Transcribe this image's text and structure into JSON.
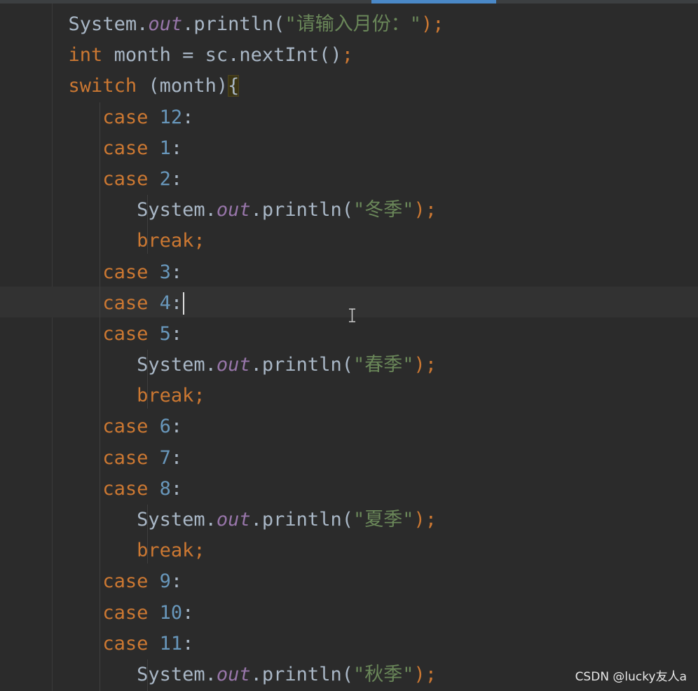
{
  "editor": {
    "lines": [
      {
        "indent": "      ",
        "tokens": [
          {
            "t": "System.",
            "c": ""
          },
          {
            "t": "out",
            "c": "fld"
          },
          {
            "t": ".println(",
            "c": ""
          },
          {
            "t": "\"请输入月份：\"",
            "c": "str"
          },
          {
            "t": ");",
            "c": "kw"
          }
        ]
      },
      {
        "indent": "      ",
        "tokens": [
          {
            "t": "int",
            "c": "kw"
          },
          {
            "t": " month = sc.nextInt()",
            "c": ""
          },
          {
            "t": ";",
            "c": "kw"
          }
        ]
      },
      {
        "indent": "      ",
        "tokens": [
          {
            "t": "switch",
            "c": "kw"
          },
          {
            "t": " (month)",
            "c": ""
          },
          {
            "t": "{",
            "c": "brace-hl"
          }
        ]
      },
      {
        "indent": "         ",
        "tokens": [
          {
            "t": "case ",
            "c": "kw"
          },
          {
            "t": "12",
            "c": "num"
          },
          {
            "t": ":",
            "c": ""
          }
        ]
      },
      {
        "indent": "         ",
        "tokens": [
          {
            "t": "case ",
            "c": "kw"
          },
          {
            "t": "1",
            "c": "num"
          },
          {
            "t": ":",
            "c": ""
          }
        ]
      },
      {
        "indent": "         ",
        "tokens": [
          {
            "t": "case ",
            "c": "kw"
          },
          {
            "t": "2",
            "c": "num"
          },
          {
            "t": ":",
            "c": ""
          }
        ]
      },
      {
        "indent": "            ",
        "tokens": [
          {
            "t": "System.",
            "c": ""
          },
          {
            "t": "out",
            "c": "fld"
          },
          {
            "t": ".println(",
            "c": ""
          },
          {
            "t": "\"冬季\"",
            "c": "str"
          },
          {
            "t": ");",
            "c": "kw"
          }
        ]
      },
      {
        "indent": "            ",
        "tokens": [
          {
            "t": "break;",
            "c": "kw"
          }
        ]
      },
      {
        "indent": "         ",
        "tokens": [
          {
            "t": "case ",
            "c": "kw"
          },
          {
            "t": "3",
            "c": "num"
          },
          {
            "t": ":",
            "c": ""
          }
        ]
      },
      {
        "indent": "         ",
        "caret": true,
        "tokens": [
          {
            "t": "case ",
            "c": "kw"
          },
          {
            "t": "4",
            "c": "num"
          },
          {
            "t": ":",
            "c": ""
          }
        ]
      },
      {
        "indent": "         ",
        "tokens": [
          {
            "t": "case ",
            "c": "kw"
          },
          {
            "t": "5",
            "c": "num"
          },
          {
            "t": ":",
            "c": ""
          }
        ]
      },
      {
        "indent": "            ",
        "tokens": [
          {
            "t": "System.",
            "c": ""
          },
          {
            "t": "out",
            "c": "fld"
          },
          {
            "t": ".println(",
            "c": ""
          },
          {
            "t": "\"春季\"",
            "c": "str"
          },
          {
            "t": ");",
            "c": "kw"
          }
        ]
      },
      {
        "indent": "            ",
        "tokens": [
          {
            "t": "break;",
            "c": "kw"
          }
        ]
      },
      {
        "indent": "         ",
        "tokens": [
          {
            "t": "case ",
            "c": "kw"
          },
          {
            "t": "6",
            "c": "num"
          },
          {
            "t": ":",
            "c": ""
          }
        ]
      },
      {
        "indent": "         ",
        "tokens": [
          {
            "t": "case ",
            "c": "kw"
          },
          {
            "t": "7",
            "c": "num"
          },
          {
            "t": ":",
            "c": ""
          }
        ]
      },
      {
        "indent": "         ",
        "tokens": [
          {
            "t": "case ",
            "c": "kw"
          },
          {
            "t": "8",
            "c": "num"
          },
          {
            "t": ":",
            "c": ""
          }
        ]
      },
      {
        "indent": "            ",
        "tokens": [
          {
            "t": "System.",
            "c": ""
          },
          {
            "t": "out",
            "c": "fld"
          },
          {
            "t": ".println(",
            "c": ""
          },
          {
            "t": "\"夏季\"",
            "c": "str"
          },
          {
            "t": ");",
            "c": "kw"
          }
        ]
      },
      {
        "indent": "            ",
        "tokens": [
          {
            "t": "break;",
            "c": "kw"
          }
        ]
      },
      {
        "indent": "         ",
        "tokens": [
          {
            "t": "case ",
            "c": "kw"
          },
          {
            "t": "9",
            "c": "num"
          },
          {
            "t": ":",
            "c": ""
          }
        ]
      },
      {
        "indent": "         ",
        "tokens": [
          {
            "t": "case ",
            "c": "kw"
          },
          {
            "t": "10",
            "c": "num"
          },
          {
            "t": ":",
            "c": ""
          }
        ]
      },
      {
        "indent": "         ",
        "tokens": [
          {
            "t": "case ",
            "c": "kw"
          },
          {
            "t": "11",
            "c": "num"
          },
          {
            "t": ":",
            "c": ""
          }
        ]
      },
      {
        "indent": "            ",
        "tokens": [
          {
            "t": "System.",
            "c": ""
          },
          {
            "t": "out",
            "c": "fld"
          },
          {
            "t": ".println(",
            "c": ""
          },
          {
            "t": "\"秋季\"",
            "c": "str"
          },
          {
            "t": ");",
            "c": "kw"
          }
        ]
      }
    ]
  },
  "watermark": "CSDN @lucky友人a",
  "colors": {
    "background": "#2b2b2b",
    "keyword": "#cc7832",
    "number": "#6897bb",
    "string": "#6a8759",
    "field": "#9876aa",
    "text": "#a9b7c6"
  }
}
